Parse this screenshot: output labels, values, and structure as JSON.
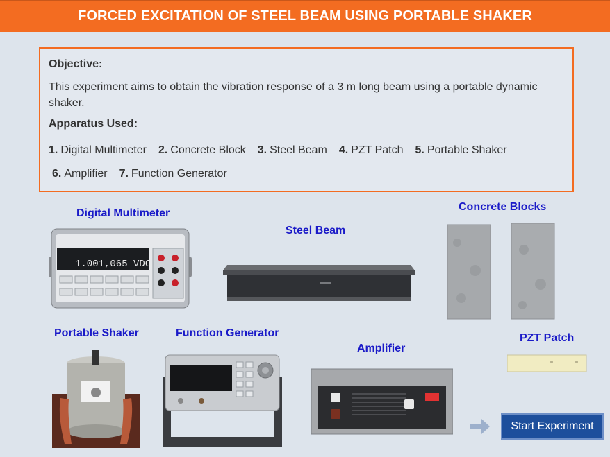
{
  "header": {
    "title": "FORCED EXCITATION OF STEEL BEAM USING PORTABLE SHAKER"
  },
  "objective": {
    "heading": "Objective:",
    "text": "This experiment aims to obtain the vibration response of a 3 m long beam using a portable dynamic shaker.",
    "apparatus_heading": "Apparatus Used:",
    "items": [
      {
        "num": "1.",
        "label": "Digital Multimeter"
      },
      {
        "num": "2.",
        "label": "Concrete Block"
      },
      {
        "num": "3.",
        "label": "Steel Beam"
      },
      {
        "num": "4.",
        "label": "PZT Patch"
      },
      {
        "num": "5.",
        "label": "Portable Shaker"
      },
      {
        "num": "6.",
        "label": "Amplifier"
      },
      {
        "num": "7.",
        "label": "Function Generator"
      }
    ]
  },
  "labels": {
    "multimeter": "Digital Multimeter",
    "beam": "Steel Beam",
    "blocks": "Concrete Blocks",
    "shaker": "Portable Shaker",
    "function_generator": "Function Generator",
    "amplifier": "Amplifier",
    "pzt": "PZT Patch"
  },
  "multimeter_display": "1.001,065 VDC",
  "start_button": "Start Experiment",
  "colors": {
    "header": "#f36c21",
    "label": "#1a1ac8",
    "button": "#1d4f9c"
  }
}
